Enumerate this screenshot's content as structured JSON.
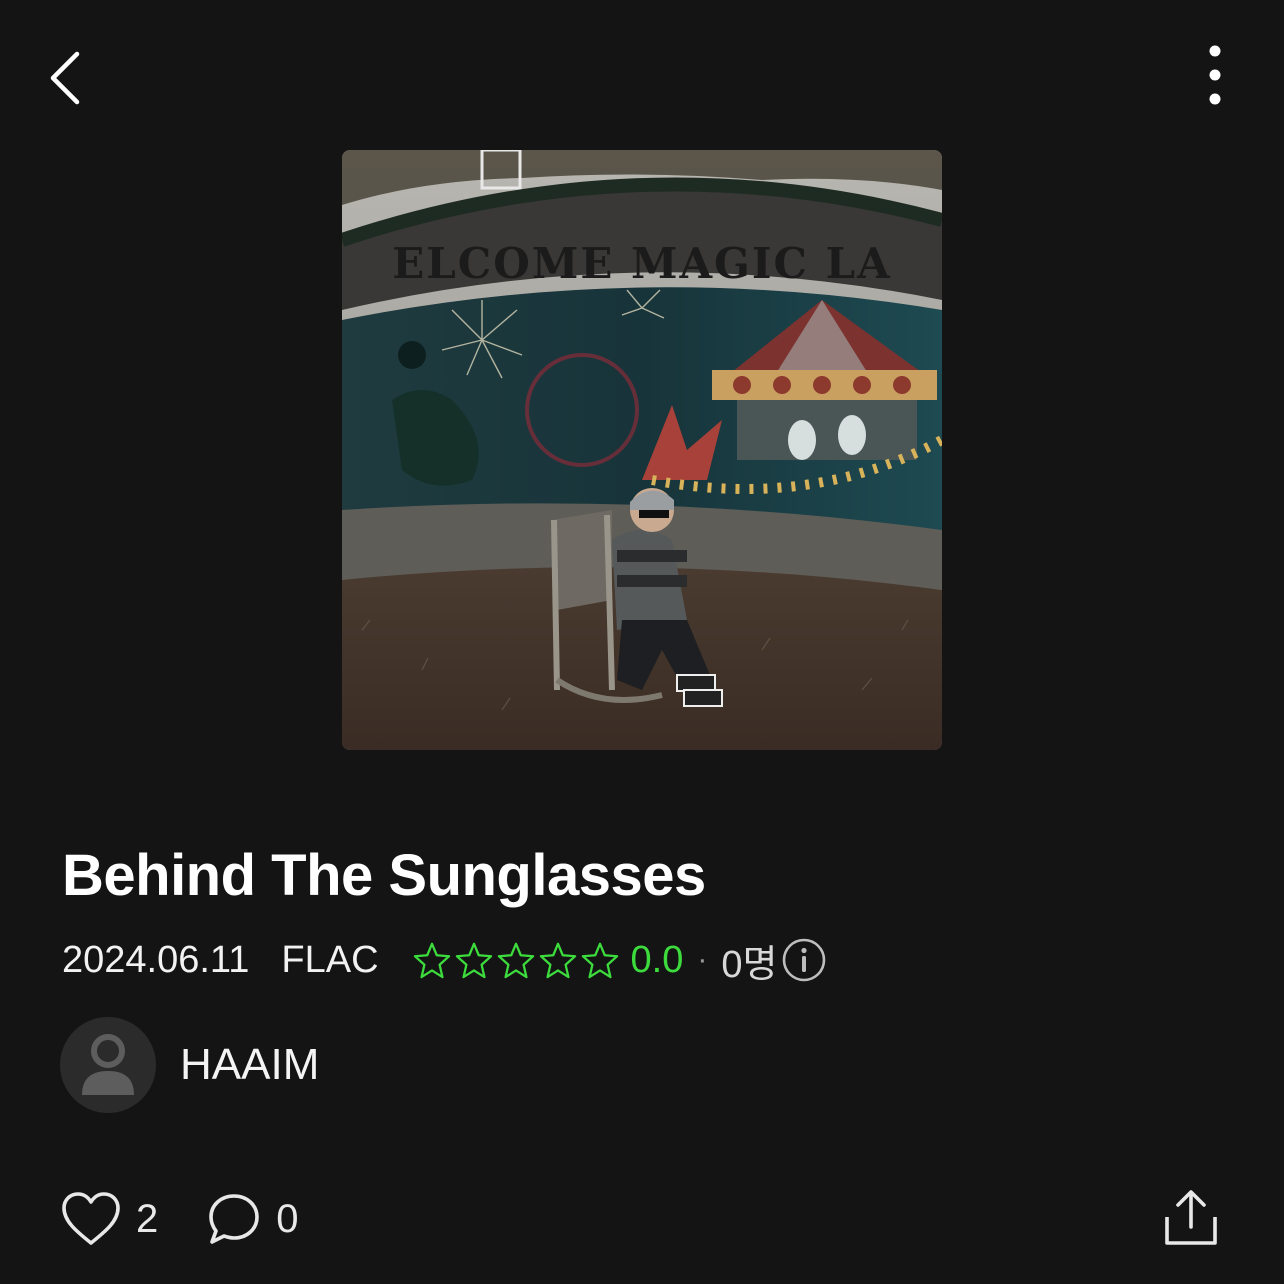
{
  "header": {
    "back_icon": "chevron-left-icon",
    "more_icon": "vertical-ellipsis-icon"
  },
  "album": {
    "cover_text": "ELCOME MAGIC LA",
    "title": "Behind The Sunglasses",
    "release_date": "2024.06.11",
    "format": "FLAC",
    "rating_value": "0.0",
    "rating_max": 5,
    "rating_separator": "·",
    "rating_count": "0명",
    "accent_color": "#3ddc3d"
  },
  "artist": {
    "name": "HAAIM",
    "avatar_icon": "user-silhouette-icon"
  },
  "actions": {
    "like_icon": "heart-icon",
    "likes": "2",
    "comment_icon": "comment-bubble-icon",
    "comments": "0",
    "share_icon": "share-icon"
  }
}
